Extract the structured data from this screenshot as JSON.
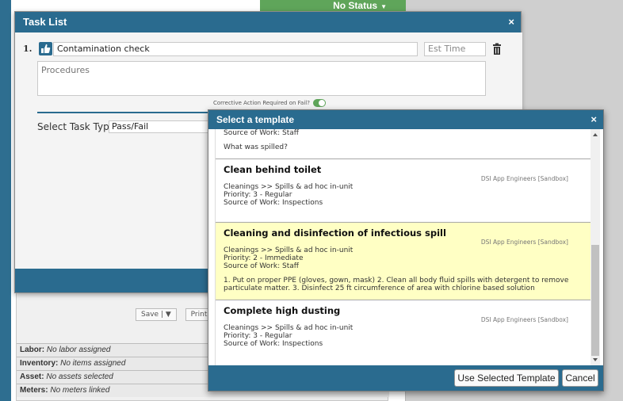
{
  "background": {
    "status_label": "No Status",
    "save_label": "Save",
    "dropdown_label": "▼",
    "print_label": "Print",
    "rows": [
      {
        "label": "Labor:",
        "value": "No labor assigned"
      },
      {
        "label": "Inventory:",
        "value": "No items assigned"
      },
      {
        "label": "Asset:",
        "value": "No assets selected"
      },
      {
        "label": "Meters:",
        "value": "No meters linked"
      }
    ]
  },
  "task_list": {
    "title": "Task List",
    "close": "×",
    "task_number": "1.",
    "task_name": "Contamination check",
    "est_time_placeholder": "Est Time",
    "procedures_placeholder": "Procedures",
    "corrective_label": "Corrective Action Required on Fail?",
    "select_type_label": "Select Task Type",
    "select_type_value": "Pass/Fail"
  },
  "template_dialog": {
    "title": "Select a template",
    "close": "×",
    "partial_item": {
      "source_of_work": "Source of Work: Staff",
      "question": "What was spilled?"
    },
    "items": [
      {
        "title": "Clean behind toilet",
        "source": "DSI App Engineers [Sandbox]",
        "category": "Cleanings >> Spills & ad hoc in-unit",
        "priority": "Priority: 3 - Regular",
        "source_of_work": "Source of Work: Inspections",
        "description": "",
        "selected": false
      },
      {
        "title": "Cleaning and disinfection of infectious spill",
        "source": "DSI App Engineers [Sandbox]",
        "category": "Cleanings >> Spills & ad hoc in-unit",
        "priority": "Priority: 2 - Immediate",
        "source_of_work": "Source of Work: Staff",
        "description": "1. Put on proper PPE (gloves, gown, mask) 2. Clean all body fluid spills with detergent to remove particulate matter. 3. Disinfect 25 ft circumference of area with chlorine based solution",
        "selected": true
      },
      {
        "title": "Complete high dusting",
        "source": "DSI App Engineers [Sandbox]",
        "category": "Cleanings >> Spills & ad hoc in-unit",
        "priority": "Priority: 3 - Regular",
        "source_of_work": "Source of Work: Inspections",
        "description": "",
        "selected": false
      }
    ],
    "use_button": "Use Selected Template",
    "cancel_button": "Cancel"
  },
  "colors": {
    "header_blue": "#2a6b8f",
    "status_green": "#5fa55a",
    "selected_highlight": "#ffffc4"
  }
}
